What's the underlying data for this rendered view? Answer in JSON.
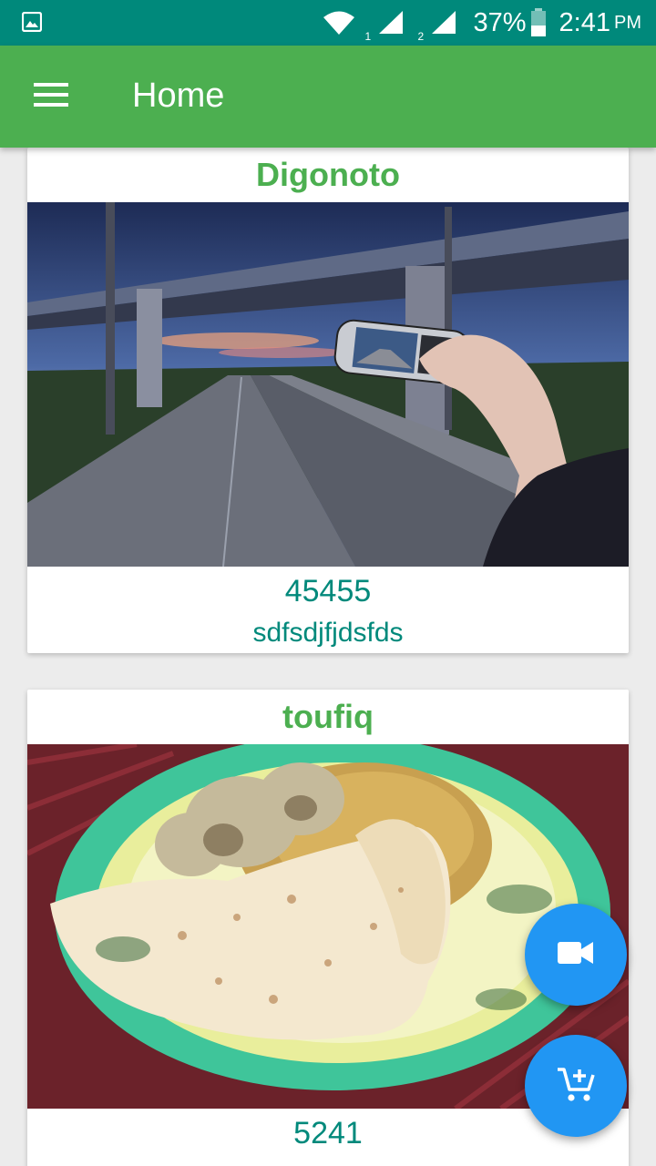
{
  "status_bar": {
    "battery": "37%",
    "time": "2:41",
    "time_suffix": "PM",
    "icons": [
      "image-icon",
      "wifi-icon",
      "signal-sim1-icon",
      "signal-sim2-icon",
      "battery-icon"
    ],
    "sim1_label": "1",
    "sim2_label": "2",
    "color": "#00897b"
  },
  "app_bar": {
    "title": "Home",
    "menu_icon": "hamburger-menu-icon",
    "color": "#4caf50"
  },
  "feed": {
    "items": [
      {
        "title": "Digonoto",
        "price": "45455",
        "description": "sdfsdjfjdsfds"
      },
      {
        "title": "toufiq",
        "price": "5241",
        "description": ""
      }
    ]
  },
  "fabs": {
    "video": {
      "icon": "videocam-icon"
    },
    "cart": {
      "icon": "add-shopping-cart-icon"
    },
    "color": "#2196f3"
  },
  "colors": {
    "accent_green": "#4caf50",
    "teal_text": "#00897b"
  }
}
